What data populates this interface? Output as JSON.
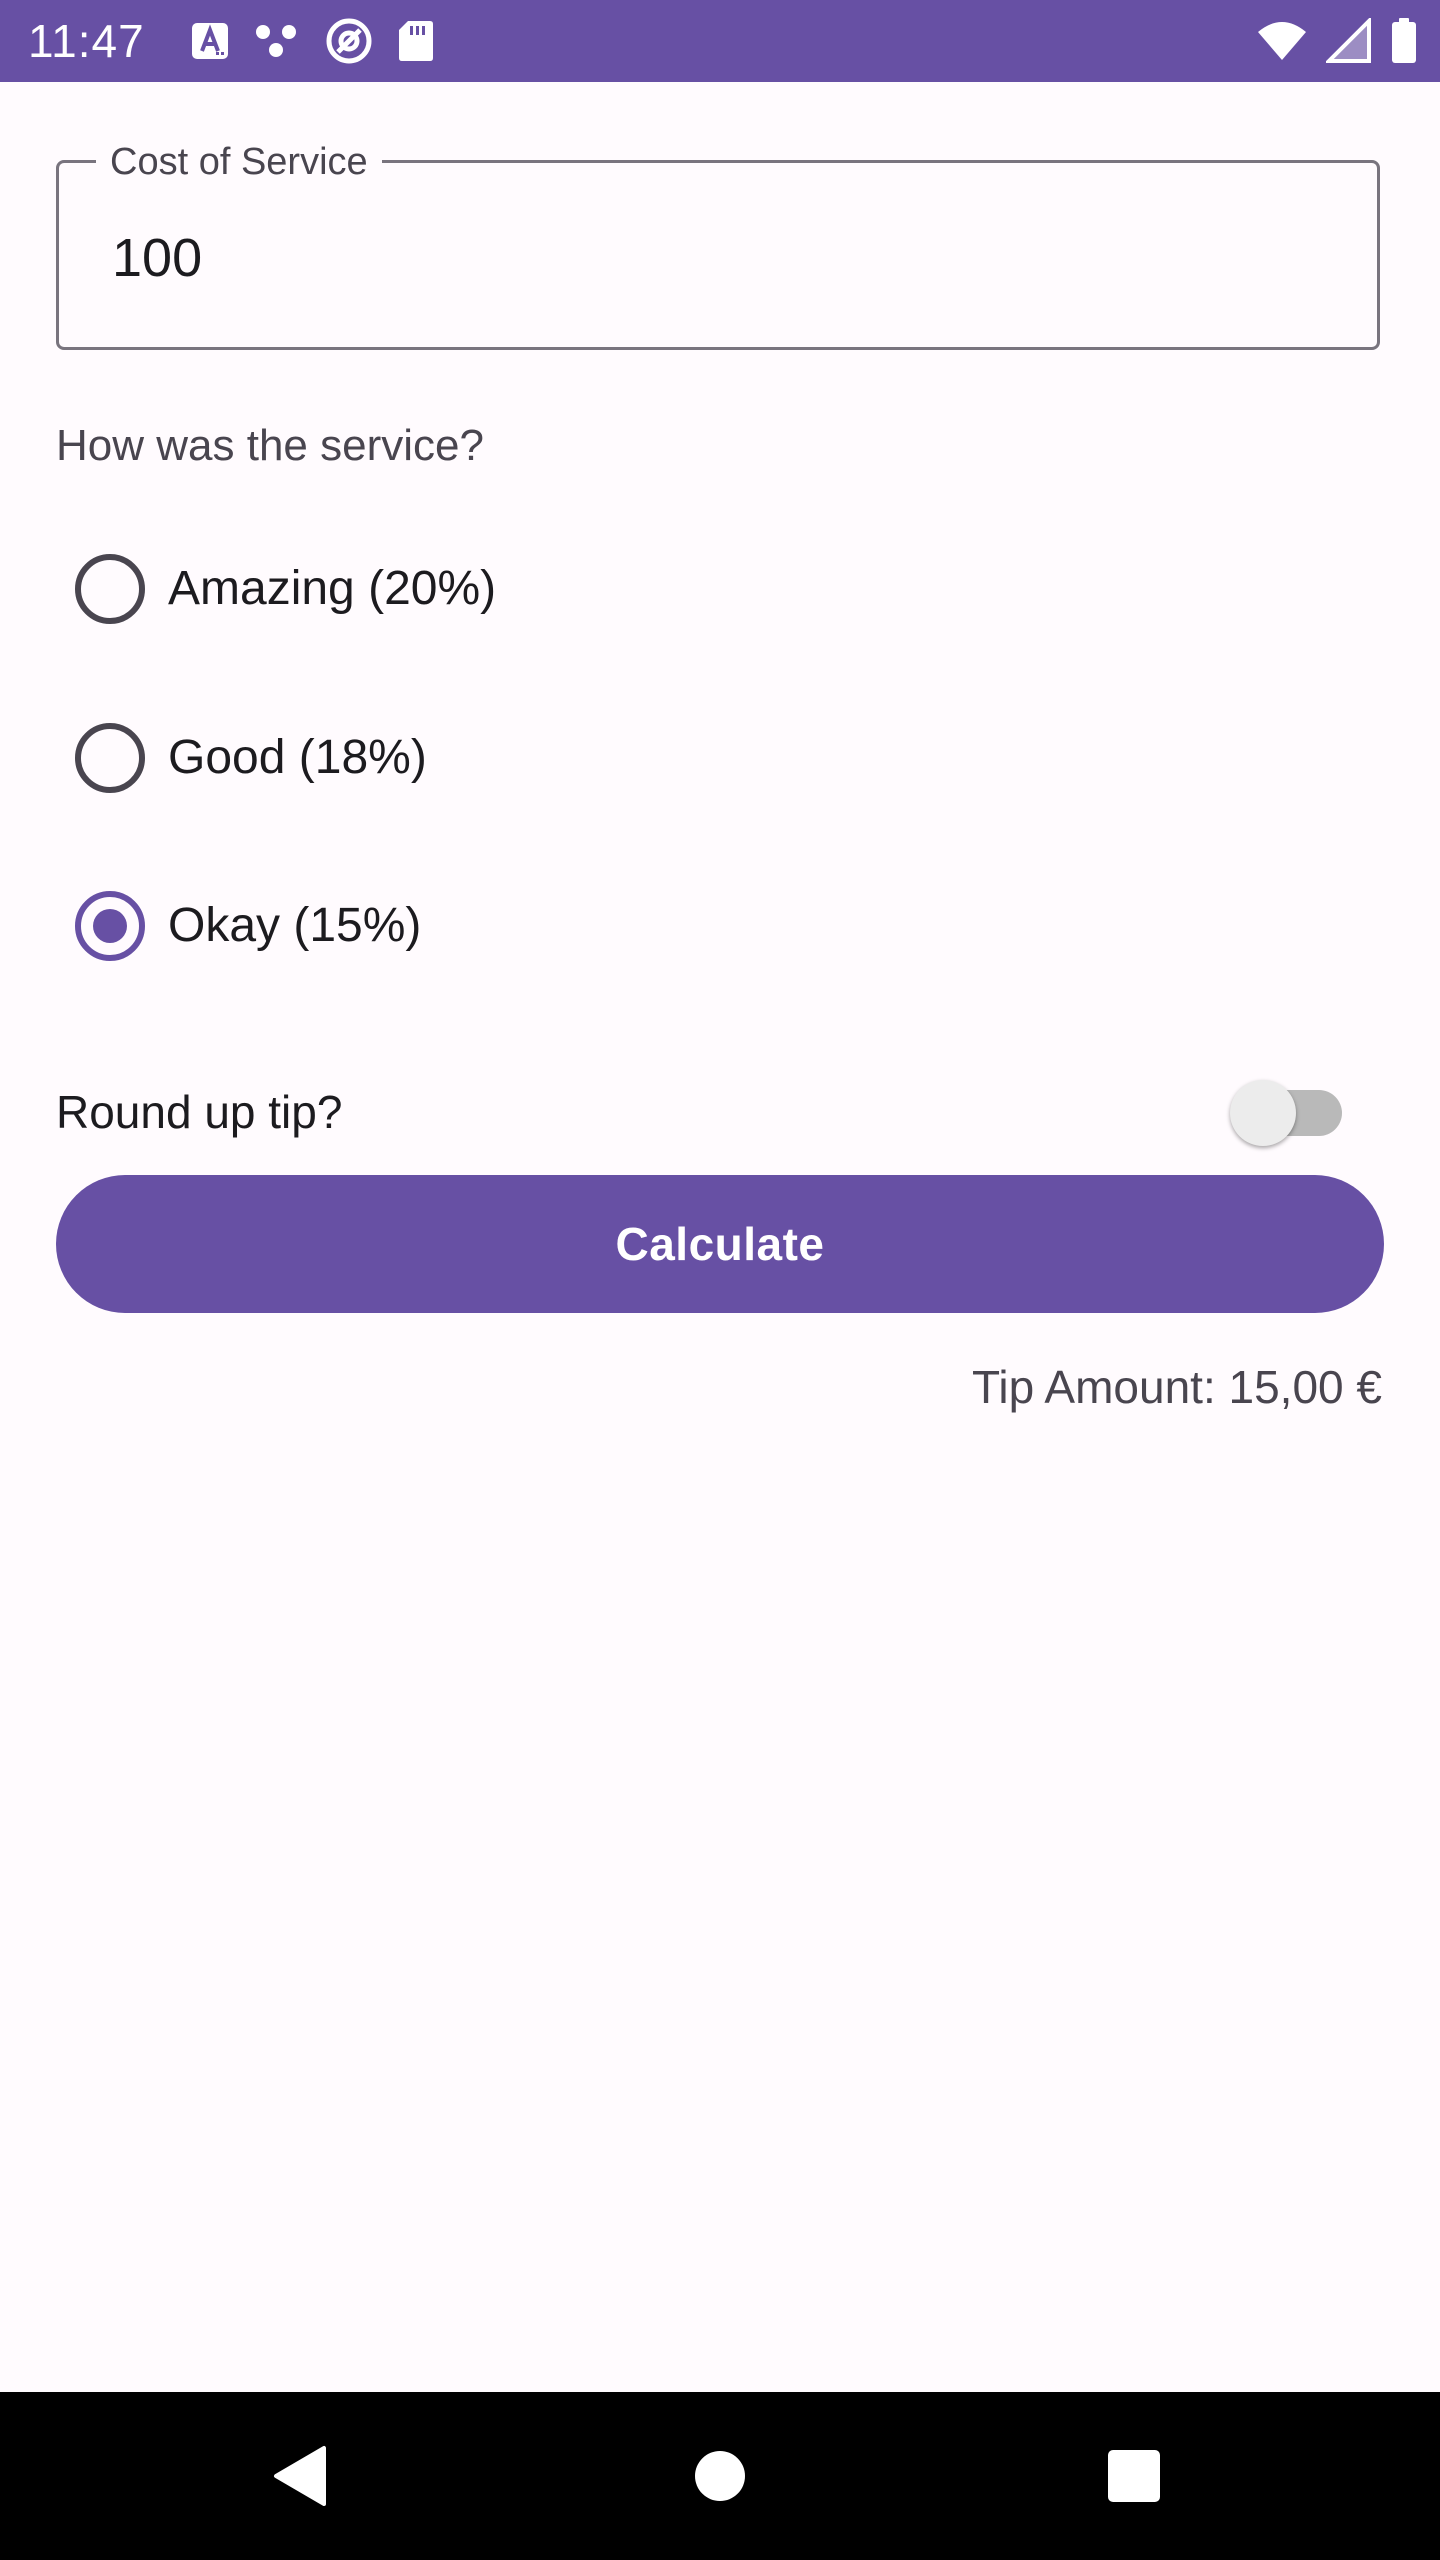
{
  "status_bar": {
    "time": "11:47",
    "left_icons": [
      "keyboard-a-icon",
      "dots-icon",
      "at-sign-icon",
      "sd-card-icon"
    ],
    "right_icons": [
      "wifi-icon",
      "signal-icon",
      "battery-icon"
    ],
    "background_color": "#6750a4"
  },
  "cost_field": {
    "label": "Cost of Service",
    "value": "100"
  },
  "service_question": "How was the service?",
  "tip_options": [
    {
      "label": "Amazing (20%)",
      "selected": false
    },
    {
      "label": "Good (18%)",
      "selected": false
    },
    {
      "label": "Okay (15%)",
      "selected": true
    }
  ],
  "round_up": {
    "label": "Round up tip?",
    "enabled": false
  },
  "calculate_button": {
    "label": "Calculate",
    "color": "#6750a4"
  },
  "tip_amount": "Tip Amount: 15,00 €",
  "nav_bar": {
    "buttons": [
      "back-icon",
      "home-icon",
      "recents-icon"
    ]
  }
}
